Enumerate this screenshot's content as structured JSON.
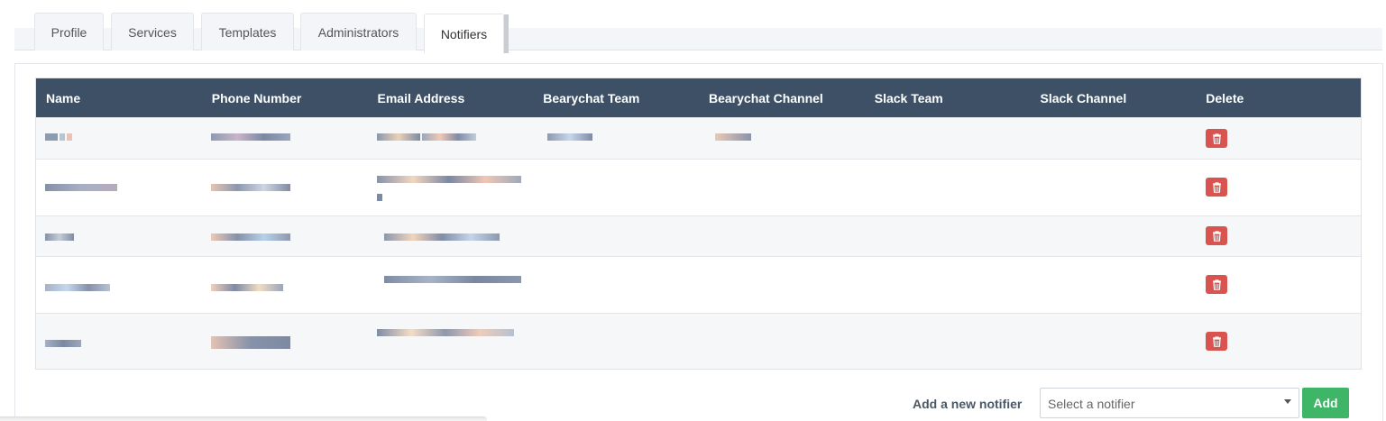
{
  "tabs": [
    {
      "label": "Profile"
    },
    {
      "label": "Services"
    },
    {
      "label": "Templates"
    },
    {
      "label": "Administrators"
    },
    {
      "label": "Notifiers",
      "active": true
    }
  ],
  "table": {
    "columns": [
      "Name",
      "Phone Number",
      "Email Address",
      "Bearychat Team",
      "Bearychat Channel",
      "Slack Team",
      "Slack Channel",
      "Delete"
    ],
    "rows": [
      {
        "name": "[redacted]",
        "phone": "[redacted]",
        "email": "[redacted]",
        "bearychat_team": "[redacted]",
        "bearychat_channel": "[redacted]",
        "slack_team": "",
        "slack_channel": ""
      },
      {
        "name": "[redacted]",
        "phone": "[redacted]",
        "email": "[redacted]",
        "bearychat_team": "",
        "bearychat_channel": "",
        "slack_team": "",
        "slack_channel": ""
      },
      {
        "name": "[redacted]",
        "phone": "[redacted]",
        "email": "[redacted]",
        "bearychat_team": "",
        "bearychat_channel": "",
        "slack_team": "",
        "slack_channel": ""
      },
      {
        "name": "[redacted]",
        "phone": "[redacted]",
        "email": "[redacted]",
        "bearychat_team": "",
        "bearychat_channel": "",
        "slack_team": "",
        "slack_channel": ""
      },
      {
        "name": "[redacted]",
        "phone": "[redacted]",
        "email": "[redacted]",
        "bearychat_team": "",
        "bearychat_channel": "",
        "slack_team": "",
        "slack_channel": ""
      }
    ]
  },
  "add_notifier": {
    "label": "Add a new notifier",
    "select_placeholder": "Select a notifier",
    "add_button": "Add"
  },
  "icons": {
    "delete": "trash-icon",
    "select_caret": "caret-down-icon"
  },
  "colors": {
    "header_bg": "#3d5066",
    "delete_button": "#d9534f",
    "add_button": "#3fb567"
  }
}
